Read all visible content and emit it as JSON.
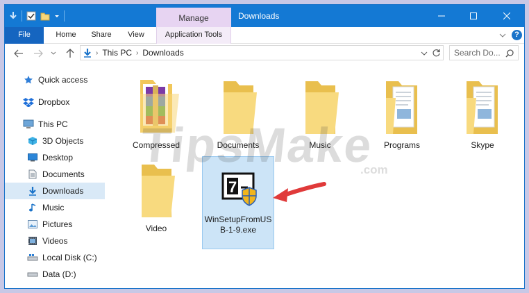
{
  "window": {
    "title": "Downloads",
    "manage_tab": "Manage",
    "minimize": "–",
    "maximize": "☐",
    "close": "✕"
  },
  "ribbon": {
    "tabs": [
      "File",
      "Home",
      "Share",
      "View",
      "Application Tools"
    ],
    "help": "?"
  },
  "address": {
    "crumbs": [
      "This PC",
      "Downloads"
    ],
    "search_placeholder": "Search Do..."
  },
  "sidebar": {
    "items": [
      {
        "label": "Quick access",
        "icon": "star-icon"
      },
      {
        "label": "Dropbox",
        "icon": "dropbox-icon"
      },
      {
        "label": "This PC",
        "icon": "computer-icon"
      },
      {
        "label": "3D Objects",
        "icon": "cube-icon"
      },
      {
        "label": "Desktop",
        "icon": "desktop-icon"
      },
      {
        "label": "Documents",
        "icon": "documents-icon"
      },
      {
        "label": "Downloads",
        "icon": "download-icon"
      },
      {
        "label": "Music",
        "icon": "music-icon"
      },
      {
        "label": "Pictures",
        "icon": "pictures-icon"
      },
      {
        "label": "Videos",
        "icon": "videos-icon"
      },
      {
        "label": "Local Disk (C:)",
        "icon": "drive-icon"
      },
      {
        "label": "Data (D:)",
        "icon": "drive-icon"
      }
    ]
  },
  "files": [
    {
      "name": "Compressed",
      "type": "archive"
    },
    {
      "name": "Documents",
      "type": "folder"
    },
    {
      "name": "Music",
      "type": "folder"
    },
    {
      "name": "Programs",
      "type": "folder-docs"
    },
    {
      "name": "Skype",
      "type": "folder-docs"
    },
    {
      "name": "Video",
      "type": "folder"
    },
    {
      "name": "WinSetupFromUSB-1-9.exe",
      "line1": "WinSetupFromUS",
      "line2": "B-1-9.exe",
      "type": "exe",
      "selected": true
    }
  ],
  "watermark": {
    "main": "TipsMake",
    "suffix": ".com"
  },
  "colors": {
    "titlebar": "#1479d4",
    "file_tab": "#1565c0",
    "manage_tab": "#e7d4f2",
    "folder": "#f7d77a",
    "selection": "#cce4f7",
    "arrow": "#e03a3a"
  }
}
